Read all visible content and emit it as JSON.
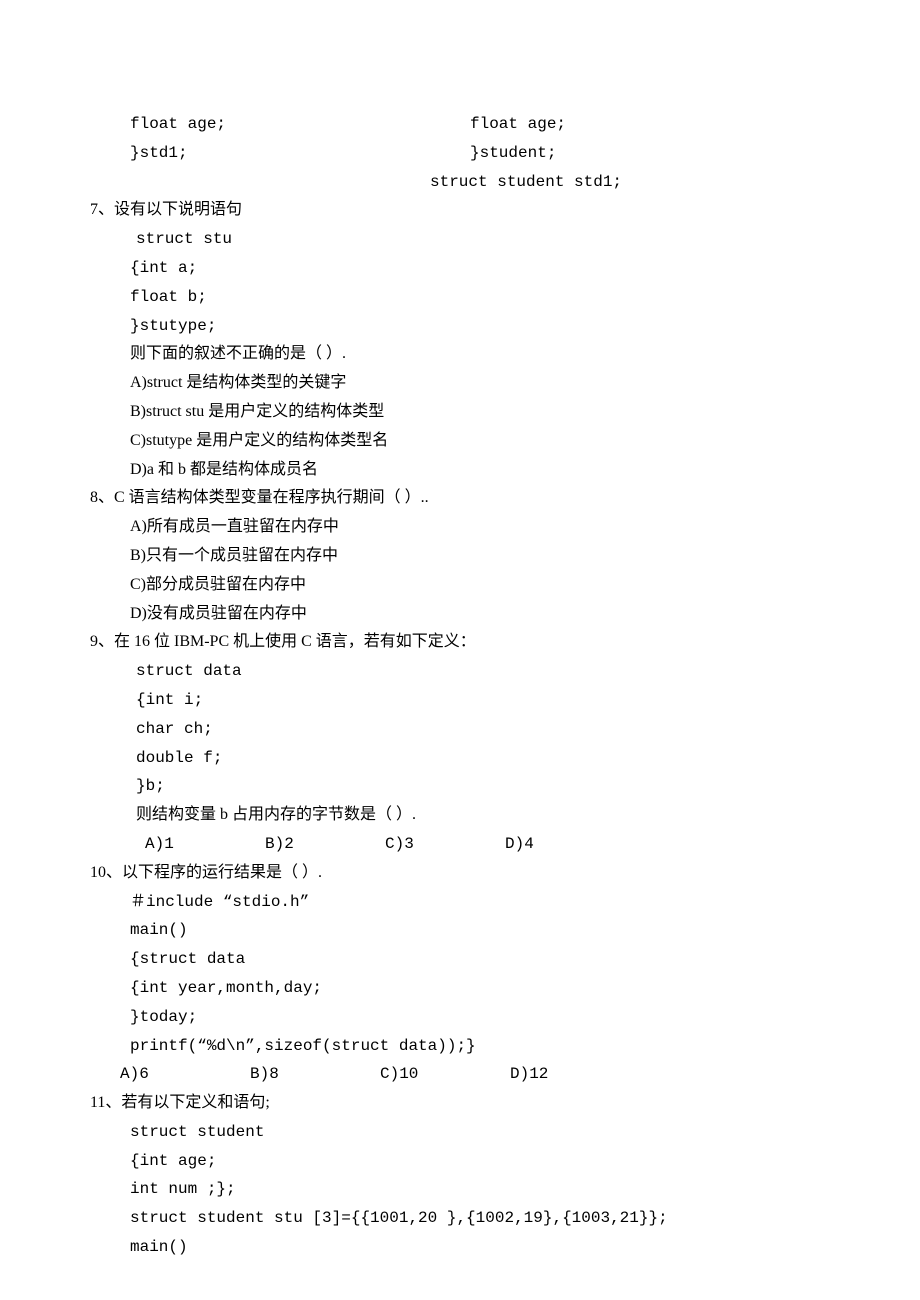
{
  "top": {
    "left_line1": "float age;",
    "left_line2": "}std1;",
    "right_line1": "float age;",
    "right_line2": "}student;",
    "right_line3": "struct student std1;"
  },
  "q7": {
    "head": "7、设有以下说明语句",
    "code": [
      "struct stu",
      "{int a;",
      " float b;",
      " }stutype;"
    ],
    "stem": "则下面的叙述不正确的是（ ）.",
    "A": "A)struct 是结构体类型的关键字",
    "B": "B)struct stu 是用户定义的结构体类型",
    "C": "C)stutype 是用户定义的结构体类型名",
    "D": "D)a 和 b 都是结构体成员名"
  },
  "q8": {
    "head": "8、C 语言结构体类型变量在程序执行期间（ ）..",
    "A": "A)所有成员一直驻留在内存中",
    "B": "B)只有一个成员驻留在内存中",
    "C": "C)部分成员驻留在内存中",
    "D": "D)没有成员驻留在内存中"
  },
  "q9": {
    "head": "9、在 16 位 IBM-PC 机上使用 C 语言，若有如下定义：",
    "code": [
      "struct data",
      "{int i;",
      " char ch;",
      " double f;",
      " }b;"
    ],
    "stem": " 则结构变量 b 占用内存的字节数是（ ）.",
    "A": "A)1",
    "B": "B)2",
    "C": "C)3",
    "D": "D)4"
  },
  "q10": {
    "head": "10、以下程序的运行结果是（ ）.",
    "code": [
      "＃include “stdio.h”",
      "main()",
      "{struct data",
      "{int year,month,day;",
      " }today;",
      " printf(“%d\\n”,sizeof(struct data));}"
    ],
    "A": "A)6",
    "B": "B)8",
    "C": "C)10",
    "D": "D)12"
  },
  "q11": {
    "head": "11、若有以下定义和语句;",
    "code": [
      "struct student",
      "{int age;",
      "int num ;};",
      "struct student stu [3]={{1001,20 },{1002,19},{1003,21}};",
      "main()"
    ]
  }
}
